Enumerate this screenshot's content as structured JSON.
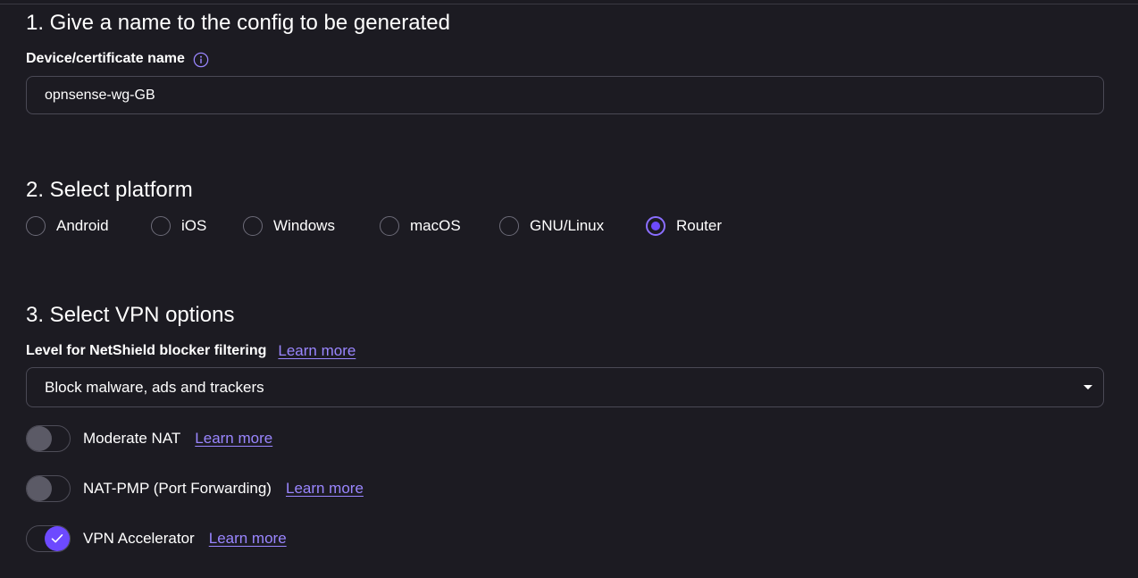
{
  "section1": {
    "title": "1. Give a name to the config to be generated",
    "field_label": "Device/certificate name",
    "input_value": "opnsense-wg-GB"
  },
  "section2": {
    "title": "2. Select platform",
    "platforms": [
      {
        "label": "Android",
        "checked": false
      },
      {
        "label": "iOS",
        "checked": false
      },
      {
        "label": "Windows",
        "checked": false
      },
      {
        "label": "macOS",
        "checked": false
      },
      {
        "label": "GNU/Linux",
        "checked": false
      },
      {
        "label": "Router",
        "checked": true
      }
    ]
  },
  "section3": {
    "title": "3. Select VPN options",
    "netshield_label": "Level for NetShield blocker filtering",
    "netshield_link": "Learn more",
    "netshield_value": "Block malware, ads and trackers",
    "toggles": [
      {
        "label": "Moderate NAT",
        "link": "Learn more",
        "on": false
      },
      {
        "label": "NAT-PMP (Port Forwarding)",
        "link": "Learn more",
        "on": false
      },
      {
        "label": "VPN Accelerator",
        "link": "Learn more",
        "on": true
      }
    ]
  },
  "colors": {
    "background": "#1c1b22",
    "accent": "#6d4aff",
    "link": "#9a86ff",
    "border": "#4a4955"
  }
}
